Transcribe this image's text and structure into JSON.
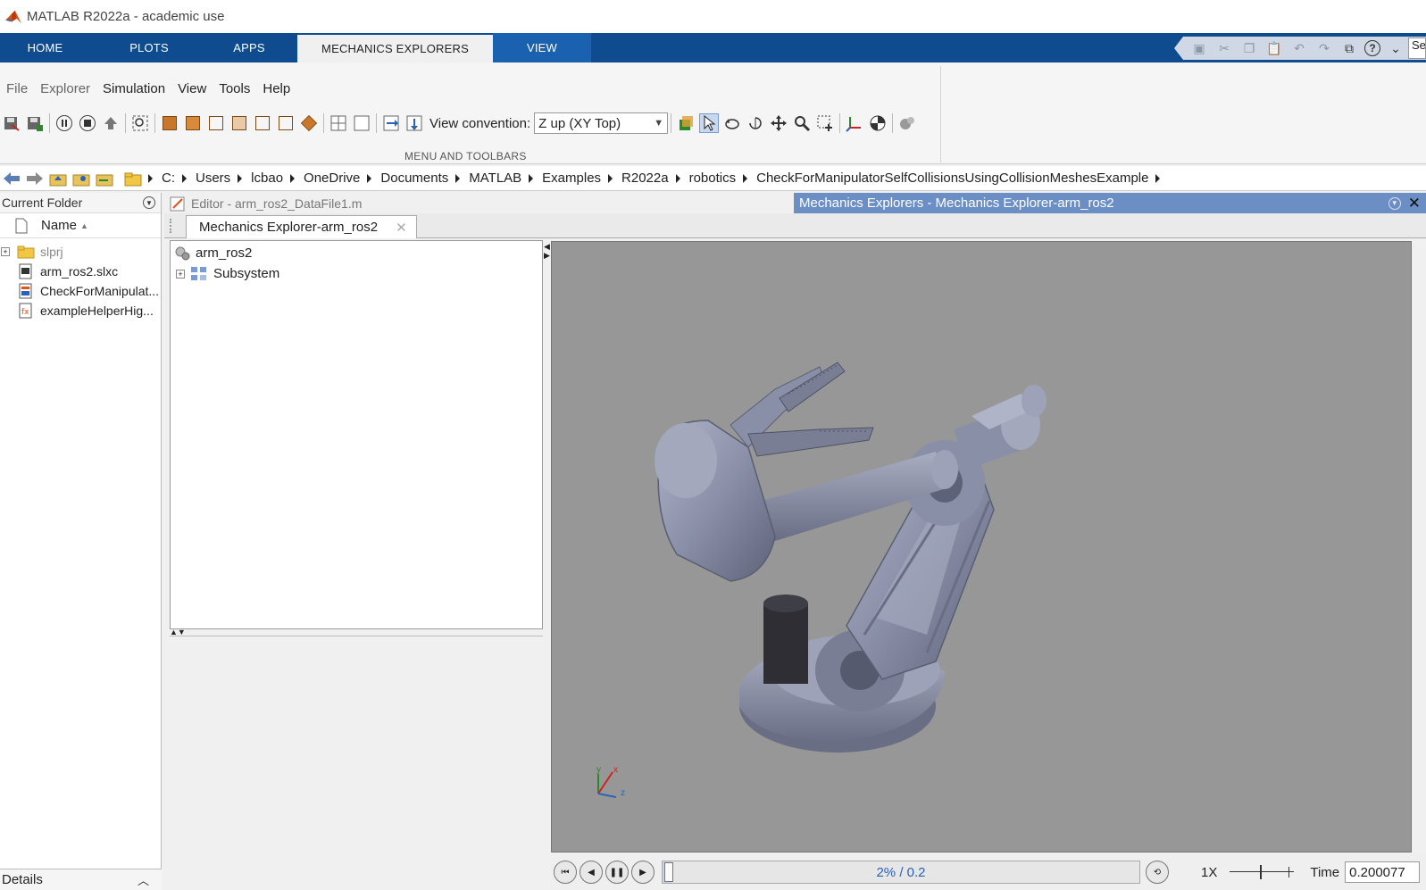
{
  "window": {
    "title": "MATLAB R2022a - academic use"
  },
  "ribbon": {
    "tabs": [
      {
        "label": "HOME"
      },
      {
        "label": "PLOTS"
      },
      {
        "label": "APPS"
      },
      {
        "label": "MECHANICS EXPLORERS"
      },
      {
        "label": "VIEW"
      }
    ],
    "search_placeholder": "Se"
  },
  "menus": {
    "file": "File",
    "explorer": "Explorer",
    "simulation": "Simulation",
    "view": "View",
    "tools": "Tools",
    "help": "Help"
  },
  "toolbar": {
    "view_convention_label": "View convention:",
    "view_convention_value": "Z up (XY Top)",
    "section_label": "MENU AND TOOLBARS"
  },
  "address": {
    "crumbs": [
      "C:",
      "Users",
      "lcbao",
      "OneDrive",
      "Documents",
      "MATLAB",
      "Examples",
      "R2022a",
      "robotics",
      "CheckForManipulatorSelfCollisionsUsingCollisionMeshesExample"
    ]
  },
  "current_folder": {
    "title": "Current Folder",
    "column_name": "Name",
    "items": [
      {
        "name": "slprj",
        "type": "folder"
      },
      {
        "name": "arm_ros2.slxc",
        "type": "slxc"
      },
      {
        "name": "CheckForManipulat...",
        "type": "mlx"
      },
      {
        "name": "exampleHelperHig...",
        "type": "m"
      }
    ],
    "details_label": "Details"
  },
  "editor": {
    "title": "Editor - arm_ros2_DataFile1.m"
  },
  "mechanics": {
    "window_title": "Mechanics Explorers - Mechanics Explorer-arm_ros2",
    "tab_label": "Mechanics Explorer-arm_ros2",
    "tree": {
      "root": "arm_ros2",
      "child": "Subsystem"
    },
    "axes": {
      "x": "x",
      "y": "y",
      "z": "z"
    }
  },
  "playback": {
    "progress_text": "2% / 0.2",
    "progress_fraction": 0.02,
    "speed_label": "1X",
    "time_label": "Time",
    "time_value": "0.200077"
  },
  "colors": {
    "ribbon_blue": "#0e4c8f",
    "viewport_gray": "#979797",
    "robot_metal": "#8a8fa8",
    "mech_header": "#6b8fc4"
  }
}
